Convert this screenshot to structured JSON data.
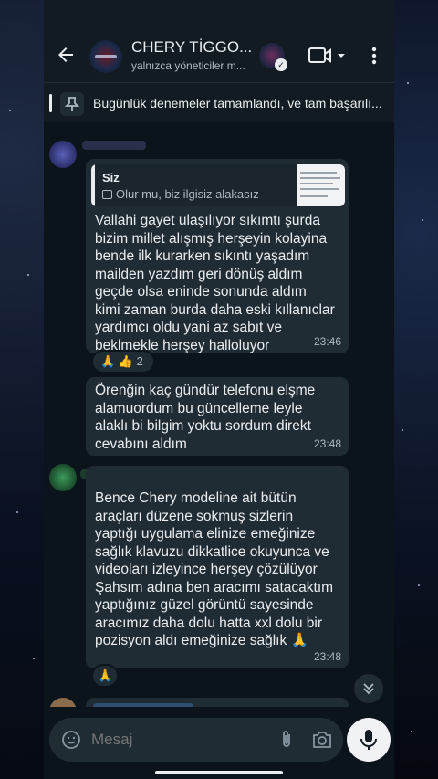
{
  "header": {
    "title": "CHERY TİGGO...",
    "subtitle": "yalnızca yöneticiler m..."
  },
  "pinned": {
    "text": "Bugünlük denemeler tamamlandı, ve tam başarılı..."
  },
  "messages": [
    {
      "quote_author": "Siz",
      "quote_text": "Olur mu, biz ilgisiz alakasız",
      "text": "Vallahi gayet ulaşılıyor sıkımtı şurda\nbizim millet alışmış herşeyin kolayina\nbende ilk kurarken sıkıntı yaşadım\nmailden yazdım geri dönüş aldım\ngeçde olsa eninde sonunda aldım\nkimi zaman burda daha eski kıllanıclar\nyardımcı oldu  yani az sabıt ve\nbeklmekle herşey halloluyor",
      "time": "23:46",
      "reactions": "🙏 👍 2"
    },
    {
      "text": "Örenğin kaç gündür telefonu elşme\nalamuordum bu güncelleme leyle\nalaklı bi bilgim yoktu sordum direkt\ncevabını aldım",
      "time": "23:48"
    },
    {
      "text": "Bence Chery modeline ait bütün\naraçları düzene sokmuş sizlerin\nyaptığı uygulama elinize emeğinize\nsağlık klavuzu dikkatlice okuyunca ve\nvideoları izleyince herşey çözülüyor\nŞahsım adına ben aracımı satacaktım\nyaptığınız güzel görüntü sayesinde\naracımız daha dolu hatta xxl dolu bir\npozisyon aldı emeğinize sağlık 🙏",
      "time": "23:48",
      "reactions": "🙏"
    }
  ],
  "input": {
    "placeholder": "Mesaj"
  },
  "colors": {
    "header_bg": "#111b21",
    "chat_bg": "#0b141a",
    "bubble_bg": "#202c33",
    "text": "#e9edef",
    "muted": "#aebac1"
  }
}
